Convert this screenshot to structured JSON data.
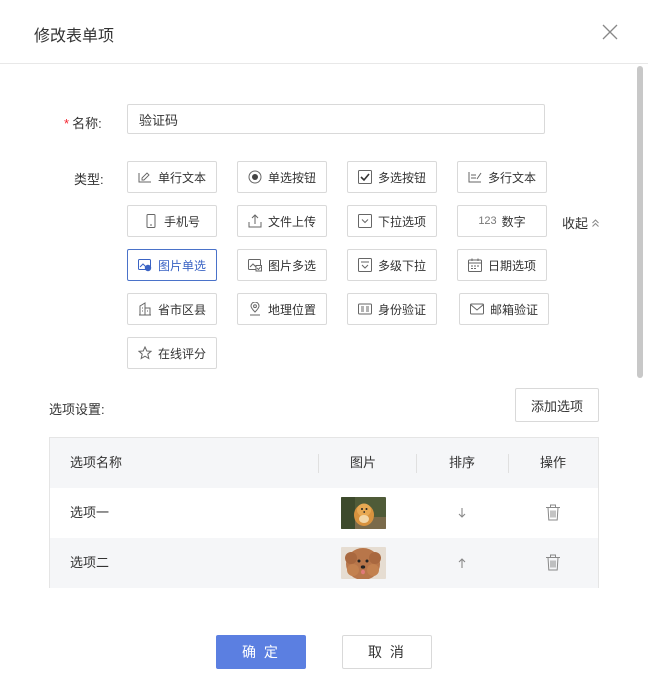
{
  "dialog": {
    "title": "修改表单项"
  },
  "form": {
    "name_required_mark": "*",
    "name_label": "名称:",
    "name_value": "验证码",
    "type_label": "类型:",
    "collapse_label": "收起",
    "options_label": "选项设置:",
    "add_option_label": "添加选项"
  },
  "types": [
    {
      "label": "单行文本",
      "icon": "single-line-text-icon"
    },
    {
      "label": "单选按钮",
      "icon": "radio-icon"
    },
    {
      "label": "多选按钮",
      "icon": "checkbox-icon"
    },
    {
      "label": "多行文本",
      "icon": "multi-line-text-icon"
    },
    {
      "label": "手机号",
      "icon": "phone-icon"
    },
    {
      "label": "文件上传",
      "icon": "upload-icon"
    },
    {
      "label": "下拉选项",
      "icon": "dropdown-icon"
    },
    {
      "label": "数字",
      "prefix": "123",
      "icon": "number-icon"
    },
    {
      "label": "图片单选",
      "icon": "image-single-icon",
      "selected": true
    },
    {
      "label": "图片多选",
      "icon": "image-multi-icon"
    },
    {
      "label": "多级下拉",
      "icon": "cascade-icon"
    },
    {
      "label": "日期选项",
      "icon": "calendar-icon"
    },
    {
      "label": "省市区县",
      "icon": "building-icon"
    },
    {
      "label": "地理位置",
      "icon": "location-icon"
    },
    {
      "label": "身份验证",
      "icon": "id-card-icon"
    },
    {
      "label": "邮箱验证",
      "icon": "mail-icon"
    },
    {
      "label": "在线评分",
      "icon": "star-icon"
    }
  ],
  "table": {
    "headers": [
      "选项名称",
      "图片",
      "排序",
      "操作"
    ],
    "rows": [
      {
        "name": "选项一",
        "sort_icon": "arrow-down-icon",
        "action_icon": "trash-icon"
      },
      {
        "name": "选项二",
        "sort_icon": "arrow-up-icon",
        "action_icon": "trash-icon"
      }
    ]
  },
  "footer": {
    "ok_label": "确 定",
    "cancel_label": "取 消"
  },
  "colors": {
    "primary": "#5b7fe1",
    "active_border": "#4a72c9",
    "required": "#f5222d"
  }
}
